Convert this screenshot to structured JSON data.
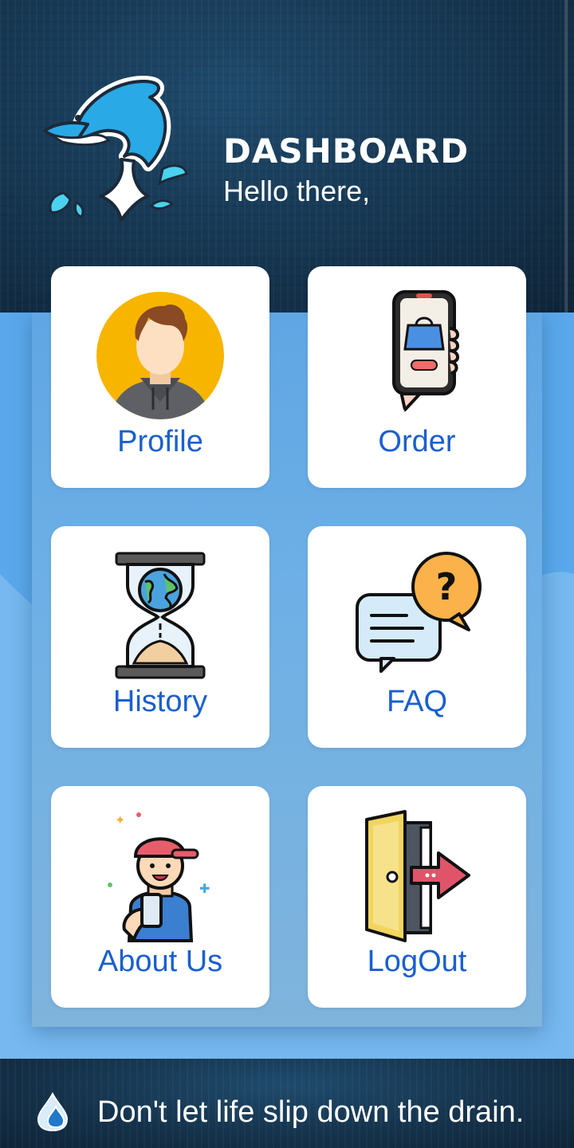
{
  "header": {
    "title": "DASHBOARD",
    "greeting": "Hello there,",
    "logo_icon": "dolphin-logo-icon"
  },
  "menu": [
    {
      "label": "Profile",
      "icon": "profile-avatar-icon"
    },
    {
      "label": "Order",
      "icon": "phone-shopping-icon"
    },
    {
      "label": "History",
      "icon": "hourglass-globe-icon"
    },
    {
      "label": "FAQ",
      "icon": "faq-chat-icon"
    },
    {
      "label": "About Us",
      "icon": "boy-with-phone-icon"
    },
    {
      "label": "LogOut",
      "icon": "exit-door-icon"
    }
  ],
  "footer": {
    "tagline": "Don't let life slip down the drain.",
    "icon": "water-drop-icon"
  },
  "colors": {
    "header_bg": "#163752",
    "panel_blue": "#5aa8eb",
    "label_blue": "#1a5fcf",
    "card_bg": "#ffffff"
  }
}
